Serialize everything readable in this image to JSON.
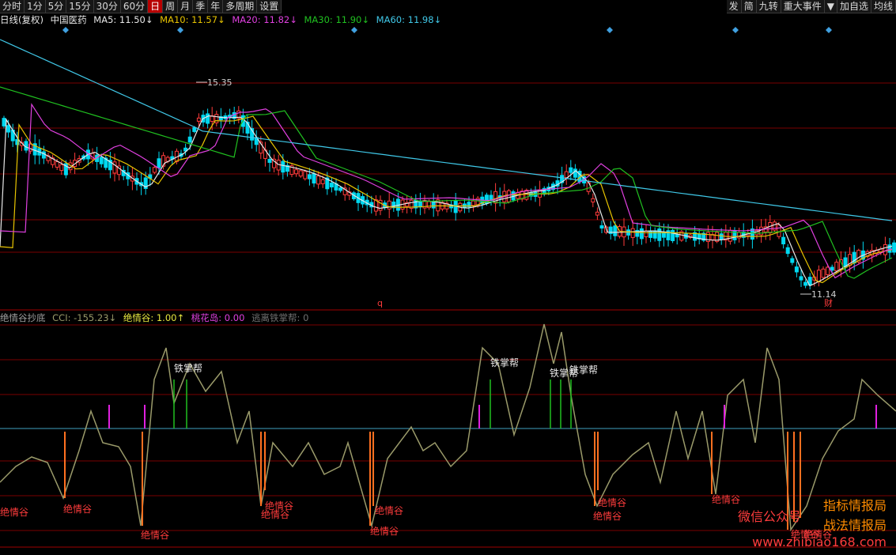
{
  "toolbar": {
    "left": [
      "分时",
      "1分",
      "5分",
      "15分",
      "30分",
      "60分",
      "日",
      "周",
      "月",
      "季",
      "年",
      "多周期",
      "设置"
    ],
    "active_index": 6,
    "right": [
      "发",
      "简",
      "九转",
      "重大事件",
      "▼",
      "加自选",
      "均线"
    ]
  },
  "main_panel": {
    "period": "日线(复权)",
    "stock": "中国医药",
    "ma": [
      {
        "label": "MA5: 11.50↓",
        "color": "#e8e8e8"
      },
      {
        "label": "MA10: 11.57↓",
        "color": "#e8c400"
      },
      {
        "label": "MA20: 11.82↓",
        "color": "#e040e0"
      },
      {
        "label": "MA30: 11.90↓",
        "color": "#20c020"
      },
      {
        "label": "MA60: 11.98↓",
        "color": "#40c8e8"
      }
    ],
    "high_label": "15.35",
    "low_label": "11.14",
    "marker_q": "q",
    "marker_cai": "财"
  },
  "sub_panel": {
    "name": "绝情谷抄底",
    "cci": "CCI: -155.23↓",
    "juequing": "绝情谷: 1.00↑",
    "taohua": "桃花岛: 0.00",
    "yuanli": "逃离铁掌帮: 0"
  },
  "annotations": {
    "tiezhang": "铁掌帮",
    "jueqinggu": "绝情谷"
  },
  "watermark": {
    "line1": "指标情报局",
    "line2": "战法情报局",
    "wechat": "微信公众号",
    "url": "www.zhibiao168.com"
  },
  "colors": {
    "up": "#ff3c3c",
    "down": "#00d8f0",
    "ma5": "#e8e8e8",
    "ma10": "#e8c400",
    "ma20": "#e040e0",
    "ma30": "#20c020",
    "ma60": "#40c8e8",
    "cci": "#9a9a6a",
    "grid": "#7a0000"
  }
}
